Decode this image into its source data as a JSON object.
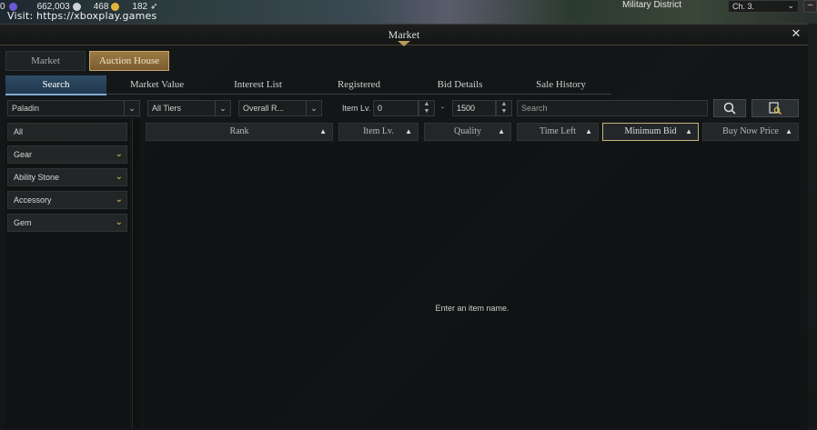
{
  "topbar": {
    "currency1": "662,003",
    "currency2": "468",
    "currency3": "182",
    "lead_digit": "0",
    "district": "Military District",
    "channel": "Ch. 3."
  },
  "watermark": "Visit: https://xboxplay.games",
  "window": {
    "title": "Market",
    "main_tabs": [
      "Market",
      "Auction House"
    ],
    "sub_tabs": [
      "Search",
      "Market Value",
      "Interest List",
      "Registered",
      "Bid Details",
      "Sale History"
    ]
  },
  "filters": {
    "class": "Paladin",
    "tier": "All Tiers",
    "sort": "Overall R...",
    "item_lv_label": "Item Lv.",
    "item_lv_min": "0",
    "item_lv_max": "1500",
    "dash": "-",
    "search_placeholder": "Search"
  },
  "categories": [
    "All",
    "Gear",
    "Ability Stone",
    "Accessory",
    "Gem"
  ],
  "columns": [
    "Rank",
    "Item Lv.",
    "Quality",
    "Time Left",
    "Minimum Bid",
    "Buy Now Price"
  ],
  "empty_message": "Enter an item name.",
  "colors": {
    "accent_gold": "#e7c44d",
    "tab_active_blue": "#2f4c66",
    "auction_tab": "#9b7a44"
  }
}
